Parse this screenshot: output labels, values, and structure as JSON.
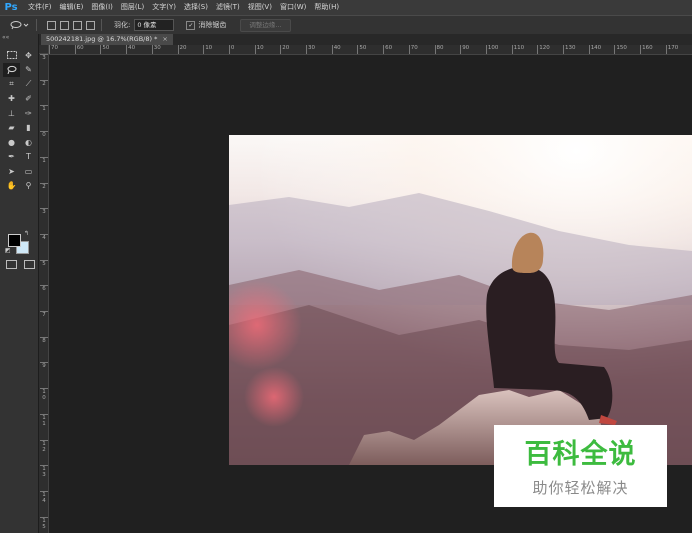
{
  "app": {
    "logo": "Ps"
  },
  "menu": [
    "文件(F)",
    "编辑(E)",
    "图像(I)",
    "图层(L)",
    "文字(Y)",
    "选择(S)",
    "滤镜(T)",
    "视图(V)",
    "窗口(W)",
    "帮助(H)"
  ],
  "options_bar": {
    "feather_label": "羽化:",
    "feather_value": "0 像素",
    "antialias_label": "消除锯齿",
    "antialias_checked": true,
    "refine_edge_label": "调整边缘..."
  },
  "document_tab": {
    "title": "500242181.jpg @ 16.7%(RGB/8) *",
    "close": "×"
  },
  "rulers": {
    "horizontal": [
      "70",
      "60",
      "50",
      "40",
      "30",
      "20",
      "10",
      "0",
      "10",
      "20",
      "30",
      "40",
      "50",
      "60",
      "70",
      "80",
      "90",
      "100",
      "110",
      "120",
      "130",
      "140",
      "150",
      "160",
      "170"
    ],
    "vertical": [
      "3",
      "2",
      "1",
      "0",
      "1",
      "2",
      "3",
      "4",
      "5",
      "6",
      "7",
      "8",
      "9",
      "10",
      "11",
      "12",
      "13",
      "14",
      "15"
    ]
  },
  "tools": [
    "marquee-icon",
    "move-icon",
    "lasso-icon",
    "quick-select-icon",
    "crop-icon",
    "eyedropper-icon",
    "healing-icon",
    "brush-icon",
    "stamp-icon",
    "history-brush-icon",
    "eraser-icon",
    "gradient-icon",
    "blur-icon",
    "dodge-icon",
    "pen-icon",
    "type-icon",
    "path-select-icon",
    "shape-icon",
    "hand-icon",
    "zoom-icon"
  ],
  "colors": {
    "foreground": "#000000",
    "background": "#cfe8f7",
    "accent": "#31a8ff"
  },
  "watermark": {
    "main": "百科全说",
    "sub": "助你轻松解决",
    "color": "#3dbb3f"
  }
}
